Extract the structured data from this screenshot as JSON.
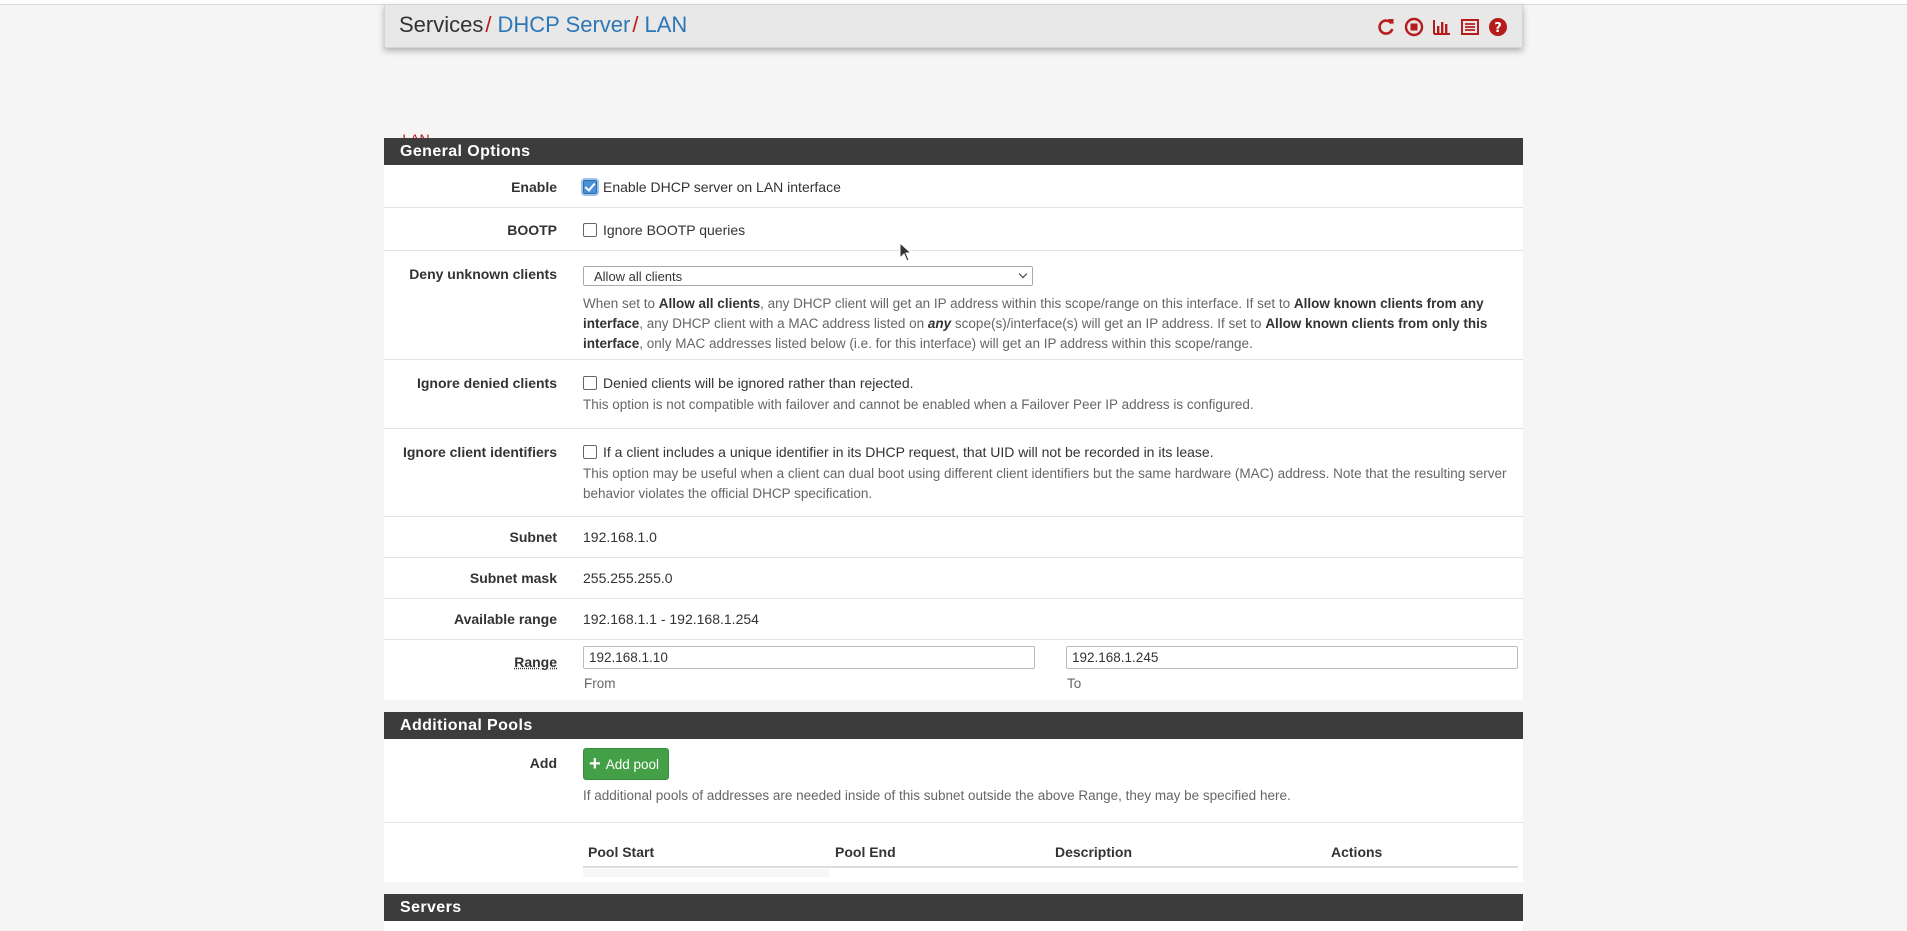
{
  "breadcrumb": {
    "root": "Services",
    "sep1": "/",
    "level1": "DHCP Server",
    "sep2": "/",
    "level2": "LAN",
    "icons": [
      "reload-icon",
      "stop-icon",
      "chart-icon",
      "list-icon",
      "help-icon"
    ]
  },
  "tabs": [
    {
      "label": "LAN",
      "active": true
    }
  ],
  "general": {
    "title": "General Options",
    "enable": {
      "label": "Enable",
      "checkbox_label": "Enable DHCP server on LAN interface",
      "checked": true
    },
    "bootp": {
      "label": "BOOTP",
      "checkbox_label": "Ignore BOOTP queries",
      "checked": false
    },
    "deny": {
      "label": "Deny unknown clients",
      "selected": "Allow all clients",
      "help": {
        "t1": "When set to ",
        "b1": "Allow all clients",
        "t2": ", any DHCP client will get an IP address within this scope/range on this interface. If set to ",
        "b2": "Allow known clients from any interface",
        "t3": ", any DHCP client with a MAC address listed on ",
        "b3": "any",
        "t4": " scope(s)/interface(s) will get an IP address. If set to ",
        "b4": "Allow known clients from only this interface",
        "t5": ", only MAC addresses listed below (i.e. for this interface) will get an IP address within this scope/range."
      }
    },
    "ignore_denied": {
      "label": "Ignore denied clients",
      "checkbox_label": "Denied clients will be ignored rather than rejected.",
      "checked": false,
      "help": "This option is not compatible with failover and cannot be enabled when a Failover Peer IP address is configured."
    },
    "ignore_ids": {
      "label": "Ignore client identifiers",
      "checkbox_label": "If a client includes a unique identifier in its DHCP request, that UID will not be recorded in its lease.",
      "checked": false,
      "help": "This option may be useful when a client can dual boot using different client identifiers but the same hardware (MAC) address. Note that the resulting server behavior violates the official DHCP specification."
    },
    "subnet": {
      "label": "Subnet",
      "value": "192.168.1.0"
    },
    "mask": {
      "label": "Subnet mask",
      "value": "255.255.255.0"
    },
    "available": {
      "label": "Available range",
      "value": "192.168.1.1 - 192.168.1.254"
    },
    "range": {
      "label": "Range",
      "from": "192.168.1.10",
      "to": "192.168.1.245",
      "from_label": "From",
      "to_label": "To"
    }
  },
  "pools": {
    "title": "Additional Pools",
    "add_label": "Add",
    "add_button": "Add pool",
    "help": "If additional pools of addresses are needed inside of this subnet outside the above Range, they may be specified here.",
    "columns": [
      "Pool Start",
      "Pool End",
      "Description",
      "Actions"
    ]
  },
  "servers": {
    "title": "Servers"
  },
  "colors": {
    "accent": "#b71c1c",
    "link": "#2d77b6",
    "header": "#3c3c3c",
    "button": "#43a047"
  }
}
